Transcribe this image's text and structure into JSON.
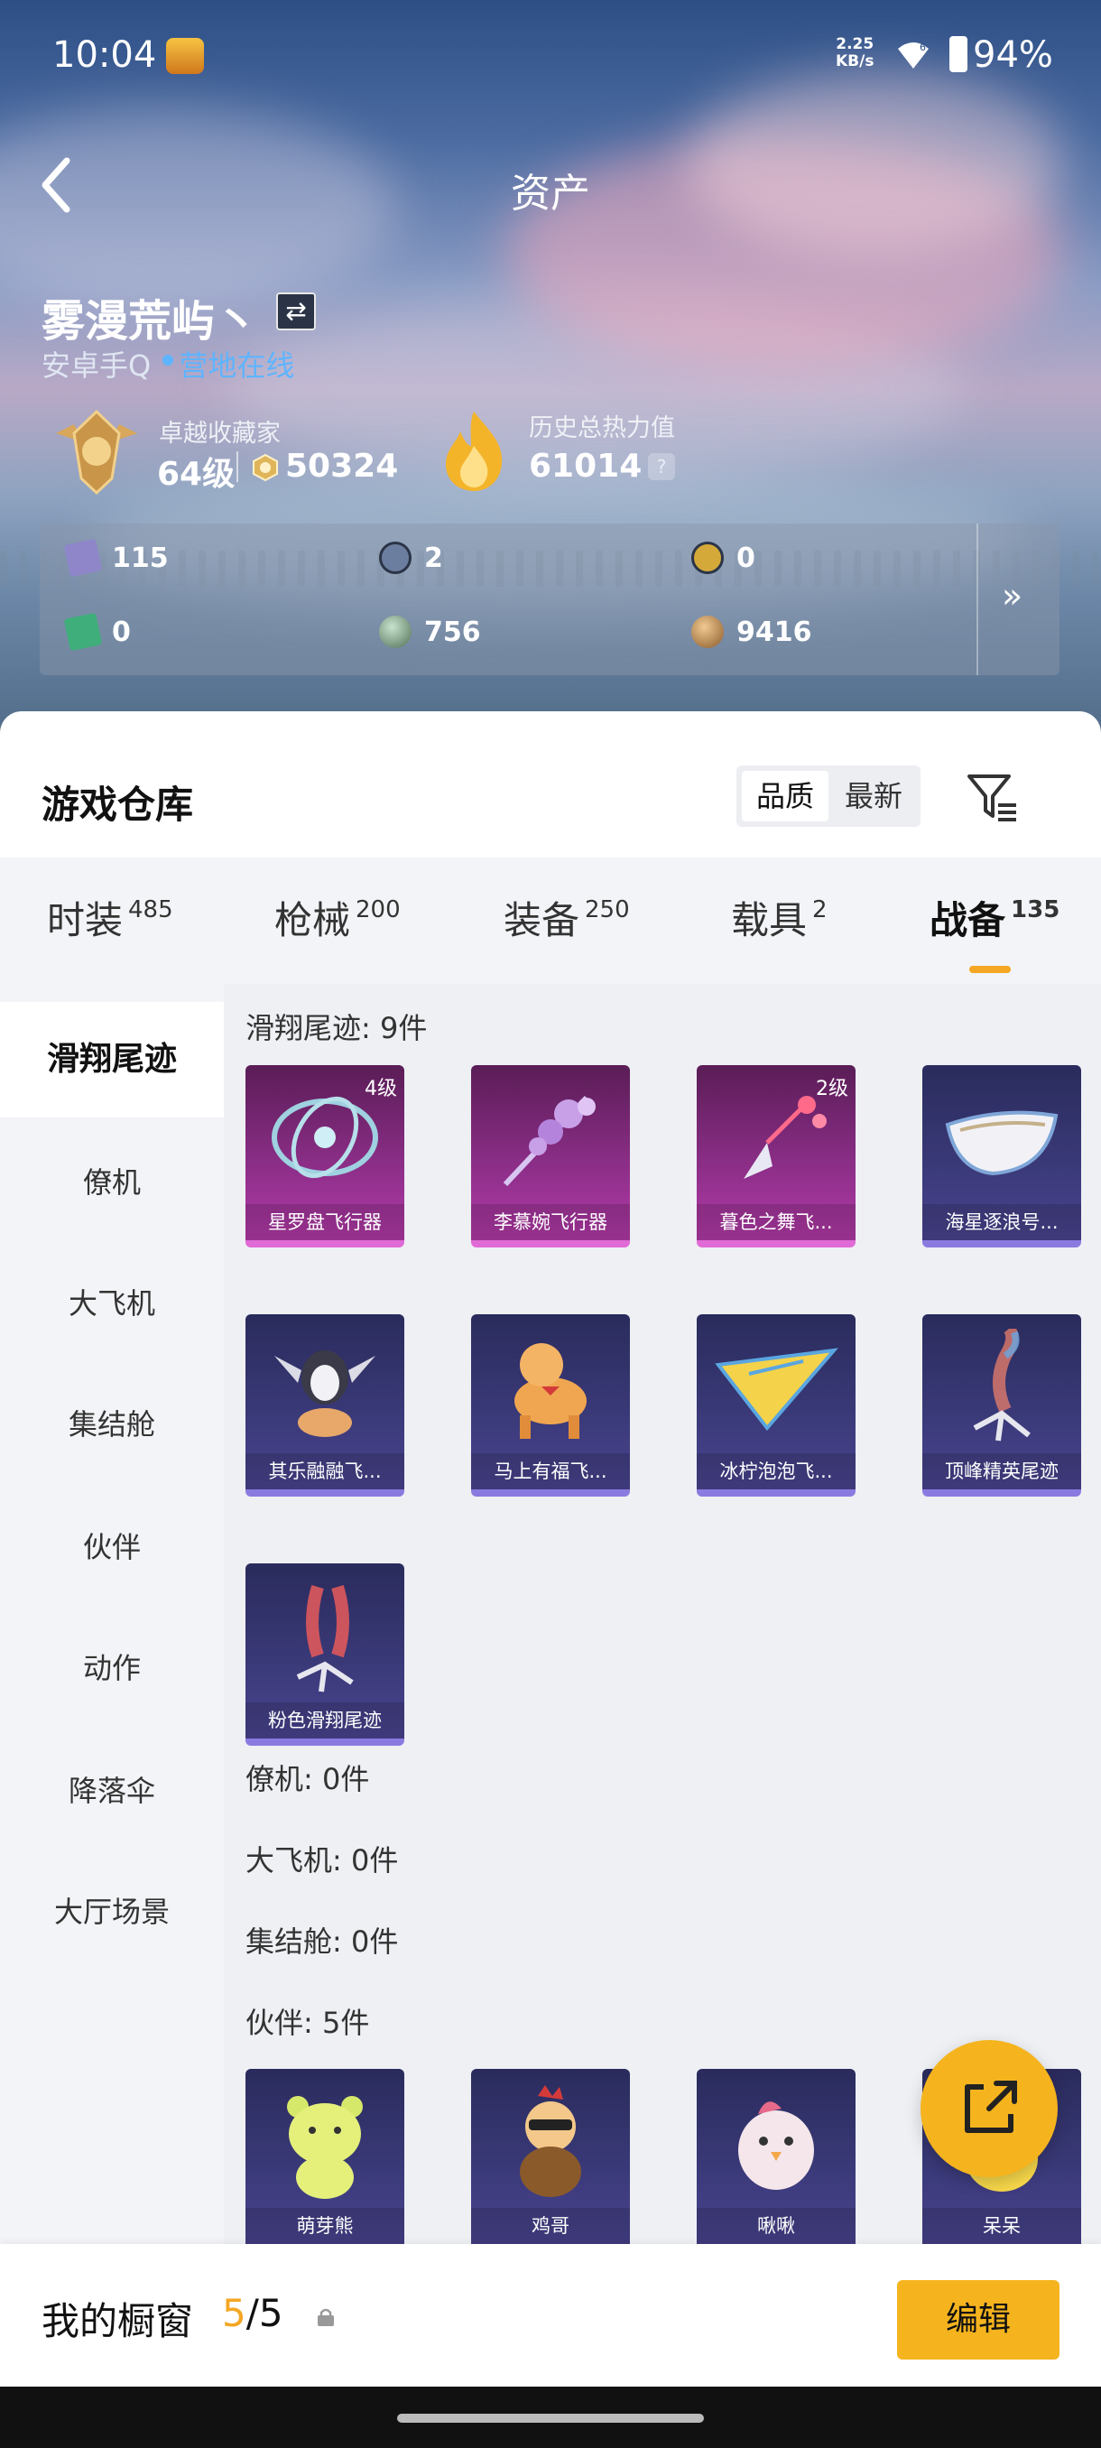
{
  "status_bar": {
    "time": "10:04",
    "speed": "2.25",
    "speed_unit": "KB/s",
    "battery": "94%"
  },
  "header": {
    "title": "资产",
    "back_icon": "chevron-left-icon"
  },
  "profile": {
    "nickname": "雾漫荒屿丶",
    "platform": "安卓手Q",
    "online_status": "营地在线",
    "rank_label": "卓越收藏家",
    "rank_level": "64级",
    "collection_score": "50324",
    "heat_label": "历史总热力值",
    "heat_value": "61014",
    "help": "?"
  },
  "currencies": [
    {
      "value": "115",
      "color": "#8e86c9",
      "icon": "card-icon"
    },
    {
      "value": "2",
      "color": "#6c7ea0",
      "icon": "token-s-icon"
    },
    {
      "value": "0",
      "color": "#d4a93a",
      "icon": "token-a-icon"
    },
    {
      "value": "0",
      "color": "#3fae7a",
      "icon": "ticket-icon"
    },
    {
      "value": "756",
      "color": "#6f8c74",
      "icon": "orb-icon"
    },
    {
      "value": "9416",
      "color": "#b4844f",
      "icon": "coin-icon"
    }
  ],
  "currency_more": "»",
  "warehouse": {
    "title": "游戏仓库",
    "sort": {
      "quality": "品质",
      "newest": "最新"
    }
  },
  "tabs": [
    {
      "label": "时装",
      "count": "485"
    },
    {
      "label": "枪械",
      "count": "200"
    },
    {
      "label": "装备",
      "count": "250"
    },
    {
      "label": "载具",
      "count": "2"
    },
    {
      "label": "战备",
      "count": "135"
    }
  ],
  "sidebar": [
    "滑翔尾迹",
    "僚机",
    "大飞机",
    "集结舱",
    "伙伴",
    "动作",
    "降落伞",
    "大厅场景"
  ],
  "sections": {
    "glide_trail": "滑翔尾迹: 9件",
    "wingman": "僚机: 0件",
    "big_plane": "大飞机: 0件",
    "rally_pod": "集结舱: 0件",
    "partner": "伙伴: 5件"
  },
  "trail_items": [
    {
      "name": "星罗盘飞行器",
      "level": "4级",
      "rarity": "pink"
    },
    {
      "name": "李慕婉飞行器",
      "level": "",
      "rarity": "pink"
    },
    {
      "name": "暮色之舞飞...",
      "level": "2级",
      "rarity": "pink"
    },
    {
      "name": "海星逐浪号...",
      "level": "",
      "rarity": "purple"
    },
    {
      "name": "其乐融融飞...",
      "level": "",
      "rarity": "purple"
    },
    {
      "name": "马上有福飞...",
      "level": "",
      "rarity": "purple"
    },
    {
      "name": "冰柠泡泡飞...",
      "level": "",
      "rarity": "purple"
    },
    {
      "name": "顶峰精英尾迹",
      "level": "",
      "rarity": "purple"
    },
    {
      "name": "粉色滑翔尾迹",
      "level": "",
      "rarity": "purple"
    }
  ],
  "partner_items": [
    {
      "name": "萌芽熊",
      "rarity": "purple"
    },
    {
      "name": "鸡哥",
      "rarity": "purple"
    },
    {
      "name": "啾啾",
      "rarity": "purple"
    },
    {
      "name": "呆呆",
      "rarity": "purple"
    }
  ],
  "showcase": {
    "label": "我的橱窗",
    "current": "5",
    "total": "/5",
    "edit": "编辑"
  }
}
